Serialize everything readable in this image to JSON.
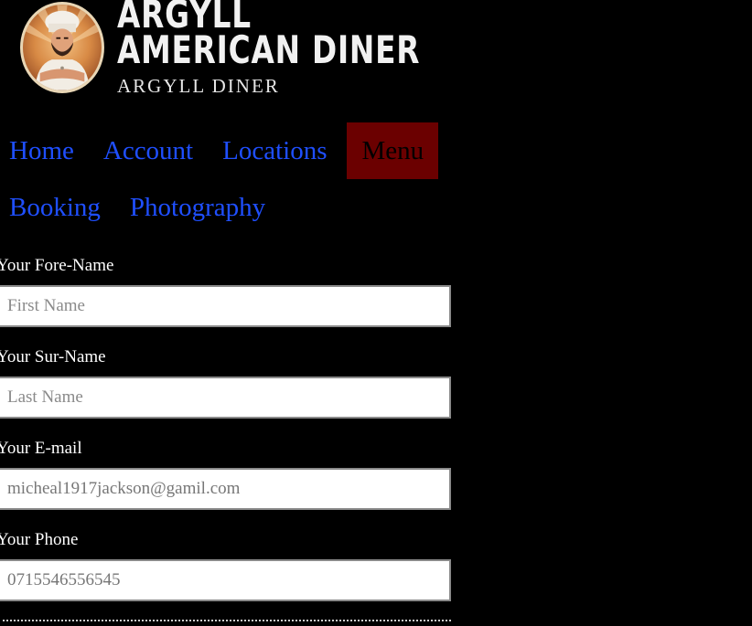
{
  "logo": {
    "line1": "ARGYLL",
    "line2": "AMERICAN DINER",
    "line3": "ARGYLL DINER",
    "badge_icon": "chef-mascot-icon"
  },
  "nav": {
    "row1": [
      {
        "label": "Home",
        "active": false
      },
      {
        "label": "Account",
        "active": false
      },
      {
        "label": "Locations",
        "active": false
      },
      {
        "label": "Menu",
        "active": true
      }
    ],
    "row2": [
      {
        "label": "Booking",
        "active": false
      },
      {
        "label": "Photography",
        "active": false
      }
    ],
    "link_color": "#1f4fff",
    "active_bg": "#6b0000"
  },
  "form": {
    "forename": {
      "label": "Your Fore-Name",
      "placeholder": "First Name",
      "value": ""
    },
    "surname": {
      "label": "Your Sur-Name",
      "placeholder": "Last Name",
      "value": ""
    },
    "email": {
      "label": "Your E-mail",
      "placeholder": "",
      "value": "micheal1917jackson@gamil.com"
    },
    "phone": {
      "label": "Your Phone",
      "placeholder": "",
      "value": "0715546556545"
    }
  }
}
